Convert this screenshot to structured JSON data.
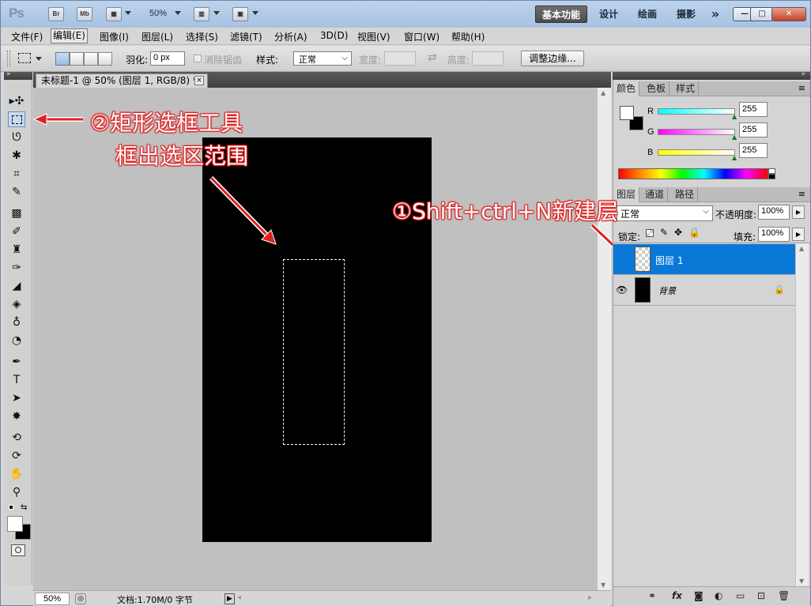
{
  "titlebar": {
    "app_logo": "Ps",
    "bridge_label": "Br",
    "minibridge_label": "Mb",
    "zoom_label": "50%",
    "workspaces": [
      "基本功能",
      "设计",
      "绘画",
      "摄影"
    ],
    "more": "»",
    "min": "—",
    "max": "□",
    "close": "✕"
  },
  "menu": [
    "文件(F)",
    "编辑(E)",
    "图像(I)",
    "图层(L)",
    "选择(S)",
    "滤镜(T)",
    "分析(A)",
    "3D(D)",
    "视图(V)",
    "窗口(W)",
    "帮助(H)"
  ],
  "options": {
    "feather_label": "羽化:",
    "feather_value": "0 px",
    "antialias_label": "消除锯齿",
    "style_label": "样式:",
    "style_value": "正常",
    "width_label": "宽度:",
    "height_label": "高度:",
    "swap": "⇄",
    "refine_edge": "调整边缘..."
  },
  "document": {
    "tab_title": "未标题-1 @ 50% (图层 1, RGB/8) *",
    "tab_close": "×",
    "zoom": "50%",
    "doc_info": "文档:1.70M/0 字节"
  },
  "annotations": {
    "step2_line1": "②矩形选框工具",
    "step2_line2": "框出选区范围",
    "step1": "①Shift+ctrl+N新建层"
  },
  "color_panel": {
    "tabs": [
      "颜色",
      "色板",
      "样式"
    ],
    "channels": [
      {
        "label": "R",
        "value": "255"
      },
      {
        "label": "G",
        "value": "255"
      },
      {
        "label": "B",
        "value": "255"
      }
    ]
  },
  "layers_panel": {
    "tabs": [
      "图层",
      "通道",
      "路径"
    ],
    "blend_mode": "正常",
    "opacity_label": "不透明度:",
    "opacity_value": "100%",
    "lock_label": "锁定:",
    "fill_label": "填充:",
    "fill_value": "100%",
    "layers": [
      {
        "name": "图层 1",
        "selected": true
      },
      {
        "name": "背景",
        "selected": false
      }
    ]
  },
  "colors": {
    "accent": "#0a78d7",
    "annotation": "#dd2222",
    "canvas": "#000000"
  }
}
